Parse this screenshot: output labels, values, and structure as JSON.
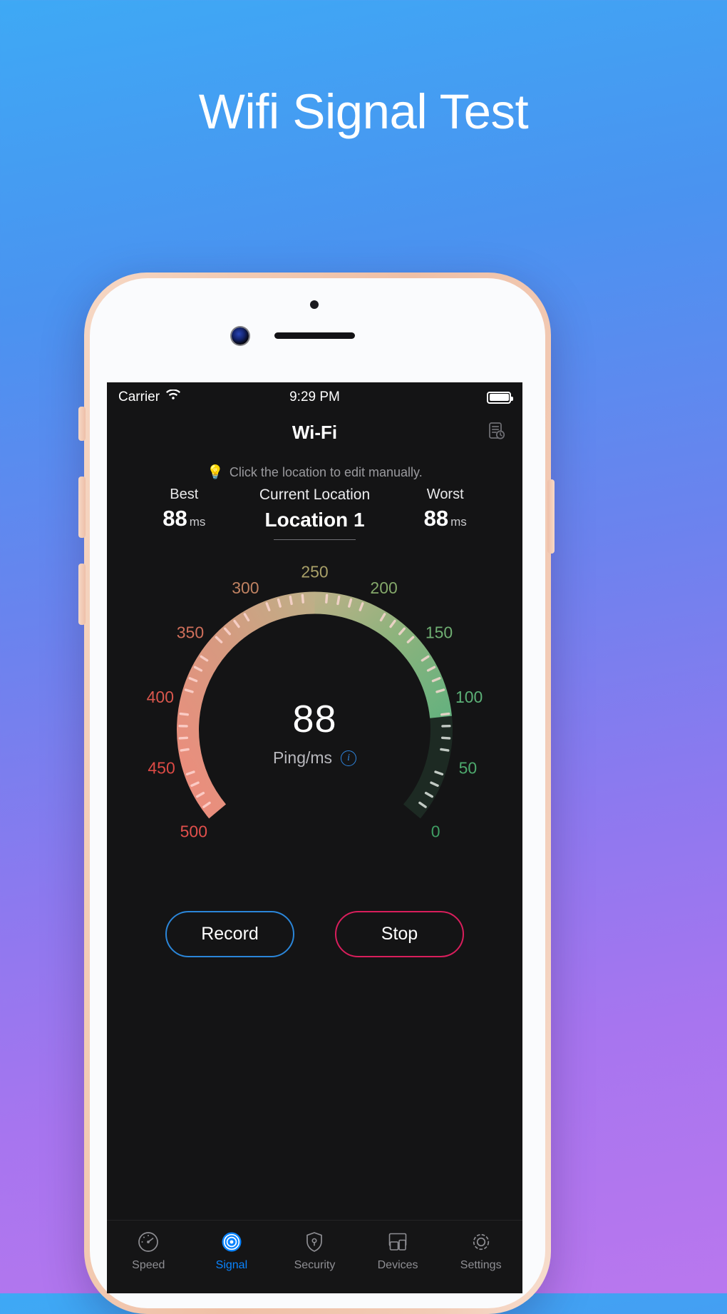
{
  "hero": {
    "title": "Wifi Signal Test"
  },
  "statusbar": {
    "carrier": "Carrier",
    "wifi_icon": "wifi-icon",
    "time": "9:29 PM",
    "battery_icon": "battery-full-icon"
  },
  "navbar": {
    "title": "Wi-Fi",
    "right_icon": "history-list-icon"
  },
  "hint": {
    "icon": "lightbulb-icon",
    "glyph": "💡",
    "text": "Click the location to edit manually."
  },
  "stats": {
    "best": {
      "label": "Best",
      "value": "88",
      "unit": "ms"
    },
    "current": {
      "label": "Current Location",
      "name": "Location 1"
    },
    "worst": {
      "label": "Worst",
      "value": "88",
      "unit": "ms"
    }
  },
  "gauge": {
    "value": "88",
    "unit_label": "Ping/ms",
    "info_icon": "info-circle-icon",
    "info_glyph": "i"
  },
  "chart_data": {
    "type": "gauge",
    "title": "Ping/ms",
    "value": 88,
    "min": 0,
    "max": 500,
    "tick_labels": [
      "0",
      "50",
      "100",
      "150",
      "200",
      "250",
      "300",
      "350",
      "400",
      "450",
      "500"
    ],
    "tick_values": [
      0,
      50,
      100,
      150,
      200,
      250,
      300,
      350,
      400,
      450,
      500
    ],
    "tick_label_colors": [
      "#3f9e63",
      "#4da96d",
      "#5cb077",
      "#6fae72",
      "#84a86a",
      "#a9a068",
      "#c08262",
      "#cf6f5b",
      "#d9574d",
      "#dd4a45",
      "#e2504c"
    ],
    "label_direction": "0 at bottom-right sweeping counter-clockwise to 500 at bottom-left, 250 at top",
    "filled_from": 0,
    "filled_to": 500,
    "active_fill_to": 88,
    "track_color_start": "#f08a7c",
    "track_color_mid": "#c2b189",
    "track_color_end": "#63b17e",
    "inactive_track_color": "#1d2a23",
    "grid": false,
    "legend": "none"
  },
  "actions": {
    "record": {
      "label": "Record",
      "color": "#2b86d9"
    },
    "stop": {
      "label": "Stop",
      "color": "#d91e5c"
    }
  },
  "tabbar": {
    "active_color": "#0a84ff",
    "inactive_color": "#8e8e93",
    "items": [
      {
        "label": "Speed",
        "icon": "speedometer-icon",
        "active": false
      },
      {
        "label": "Signal",
        "icon": "signal-wave-icon",
        "active": true
      },
      {
        "label": "Security",
        "icon": "shield-lock-icon",
        "active": false
      },
      {
        "label": "Devices",
        "icon": "devices-icon",
        "active": false
      },
      {
        "label": "Settings",
        "icon": "gear-icon",
        "active": false
      }
    ]
  }
}
